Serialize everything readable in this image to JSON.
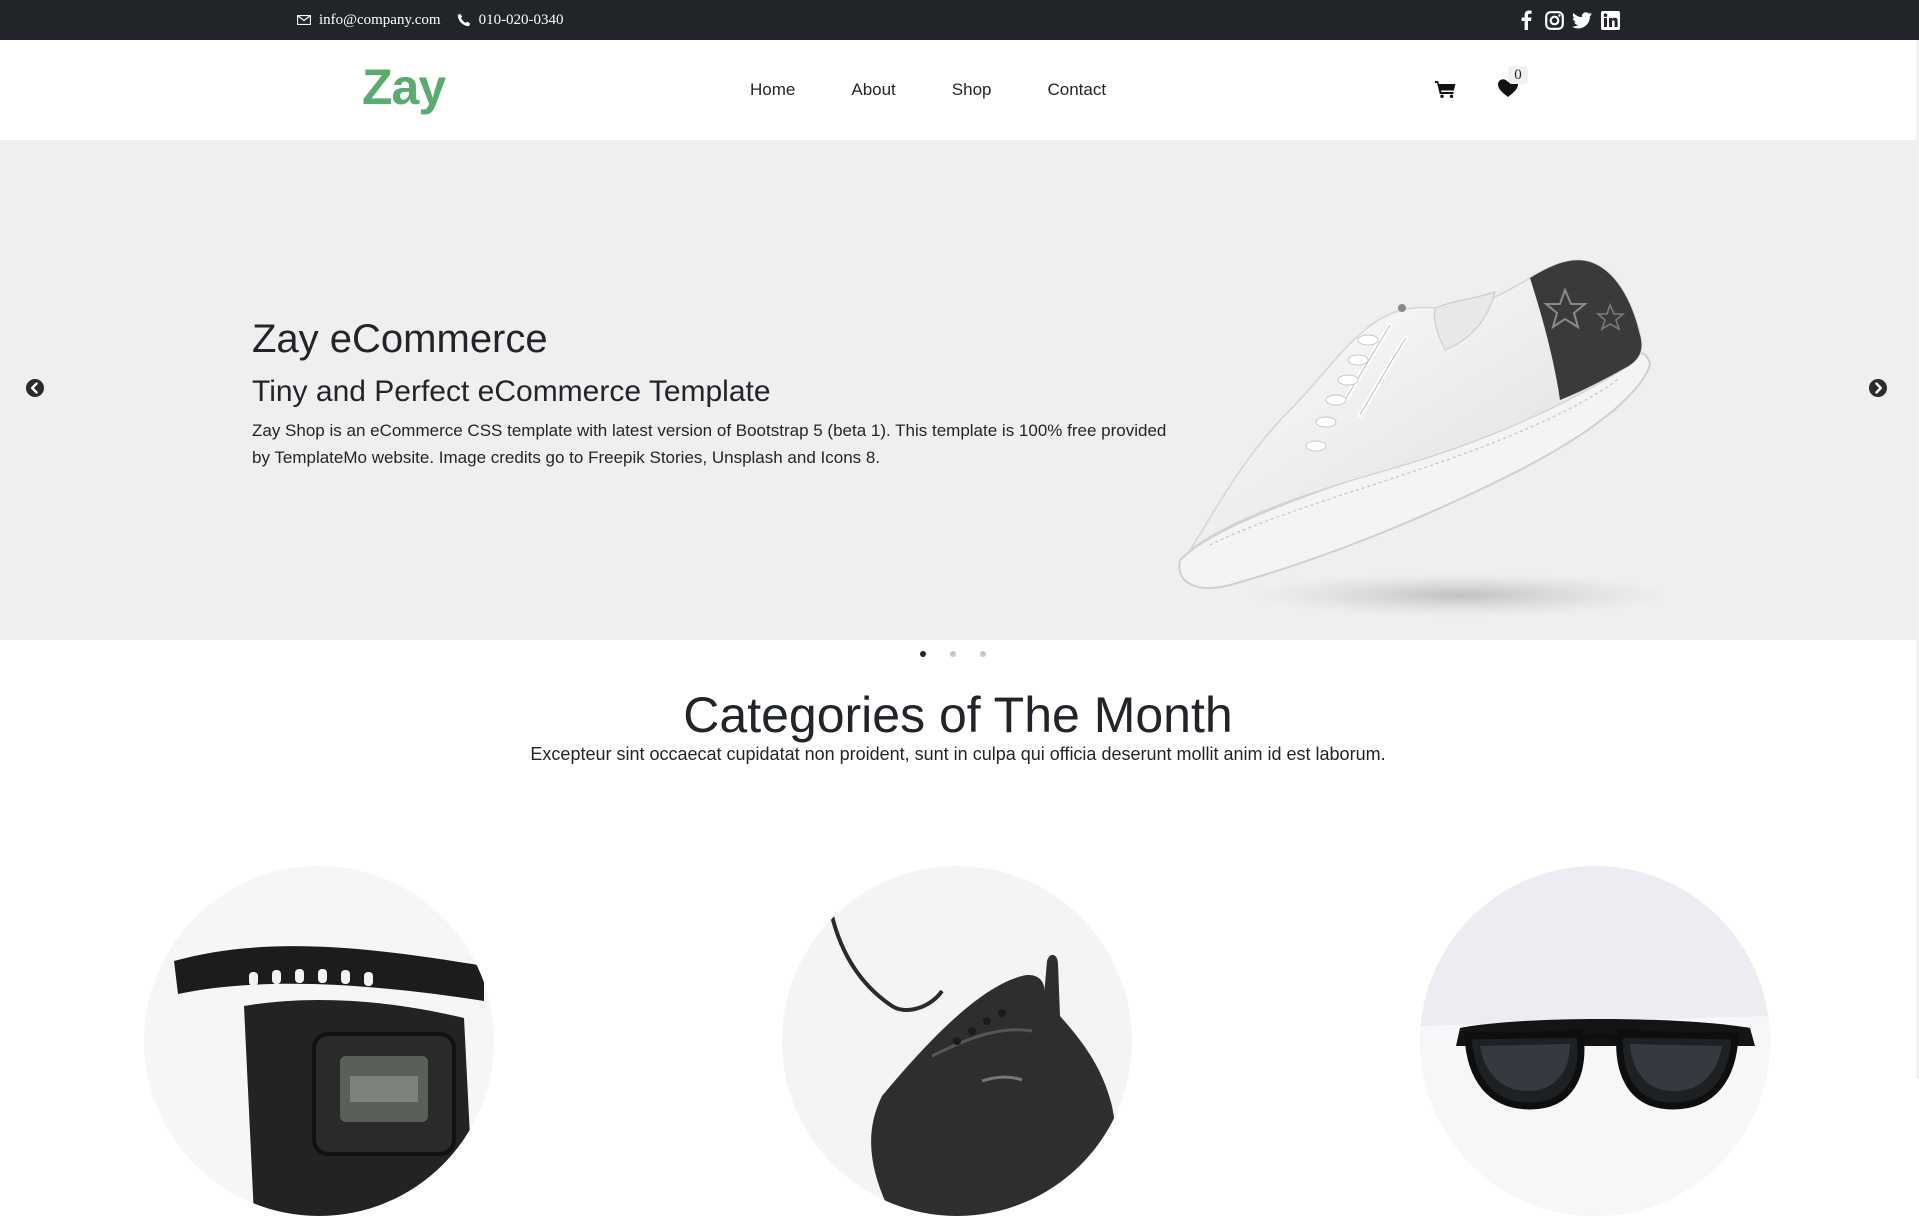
{
  "topbar": {
    "email": "info@company.com",
    "phone": "010-020-0340",
    "email_icon": "envelope-icon",
    "phone_icon": "phone-icon",
    "social": [
      "facebook-icon",
      "instagram-icon",
      "twitter-icon",
      "linkedin-icon"
    ]
  },
  "nav": {
    "logo": "Zay",
    "menu": [
      "Home",
      "About",
      "Shop",
      "Contact"
    ],
    "cart_icon": "cart-icon",
    "wishlist_icon": "heart-icon",
    "wishlist_count": "0"
  },
  "hero": {
    "title": "Zay eCommerce",
    "subtitle": "Tiny and Perfect eCommerce Template",
    "description": "Zay Shop is an eCommerce CSS template with latest version of Bootstrap 5 (beta 1). This template is 100% free provided by TemplateMo website. Image credits go to Freepik Stories, Unsplash and Icons 8.",
    "prev_icon": "chevron-left-circle-icon",
    "next_icon": "chevron-right-circle-icon",
    "slides_count": 3,
    "active_slide": 1
  },
  "categories": {
    "title": "Categories of The Month",
    "subtitle": "Excepteur sint occaecat cupidatat non proident, sunt in culpa qui officia deserunt mollit anim id est laborum."
  },
  "colors": {
    "brand": "#59ab6e",
    "topbar_bg": "#212529",
    "hero_bg": "#efefef",
    "text": "#212529"
  }
}
